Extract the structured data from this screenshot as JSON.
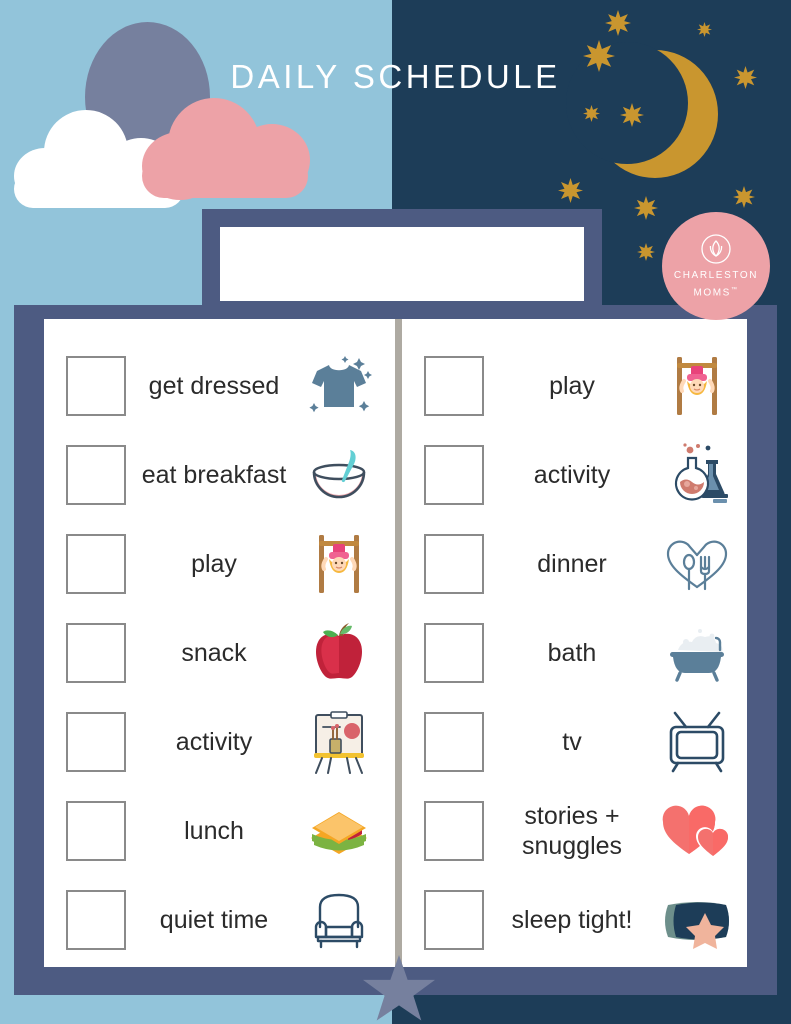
{
  "page": {
    "title": "DAILY SCHEDULE"
  },
  "brand": {
    "line1": "CHARLESTON",
    "line2": "MOMS",
    "trademark": "™"
  },
  "name_field": {
    "value": "",
    "placeholder": ""
  },
  "colors": {
    "sky_day": "#92c4da",
    "sky_night": "#1d3d58",
    "frame": "#4d5b82",
    "card": "#ffffff",
    "divider": "#aeaaa2",
    "moon": "#c9962f",
    "star_gold": "#c9962f",
    "star_slate": "#76809e",
    "cloud_pink": "#eda2a7",
    "sun": "#76809e",
    "label_text": "#2b2b2b",
    "checkbox_border": "#8a8a8a",
    "logo_bg": "#eda2a7"
  },
  "columns": {
    "left": [
      {
        "label": "get dressed",
        "icon": "tshirt-icon",
        "checked": false
      },
      {
        "label": "eat breakfast",
        "icon": "bowl-spoon-icon",
        "checked": false
      },
      {
        "label": "play",
        "icon": "swing-child-icon",
        "checked": false
      },
      {
        "label": "snack",
        "icon": "apple-icon",
        "checked": false
      },
      {
        "label": "activity",
        "icon": "easel-icon",
        "checked": false
      },
      {
        "label": "lunch",
        "icon": "sandwich-icon",
        "checked": false
      },
      {
        "label": "quiet time",
        "icon": "armchair-icon",
        "checked": false
      }
    ],
    "right": [
      {
        "label": "play",
        "icon": "swing-child-icon",
        "checked": false
      },
      {
        "label": "activity",
        "icon": "science-flask-icon",
        "checked": false
      },
      {
        "label": "dinner",
        "icon": "heart-utensils-icon",
        "checked": false
      },
      {
        "label": "bath",
        "icon": "bathtub-icon",
        "checked": false
      },
      {
        "label": "tv",
        "icon": "television-icon",
        "checked": false
      },
      {
        "label": "stories + snuggles",
        "icon": "two-hearts-icon",
        "checked": false
      },
      {
        "label": "sleep tight!",
        "icon": "pillow-star-icon",
        "checked": false
      }
    ]
  }
}
